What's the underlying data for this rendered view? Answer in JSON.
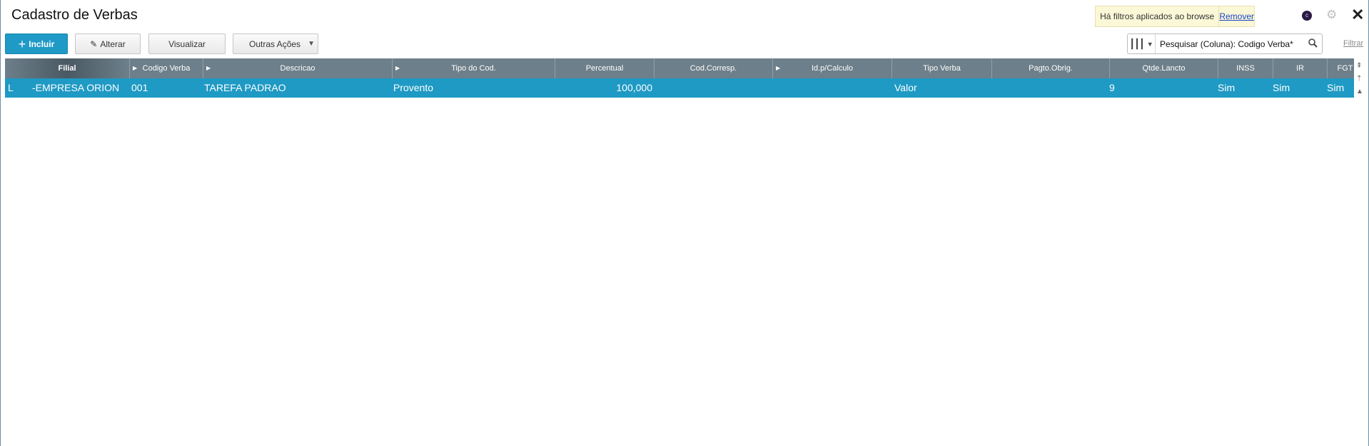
{
  "window": {
    "title": "Cadastro de Verbas",
    "filter_notice": "Há filtros aplicados ao browse",
    "filter_remove": "Remover"
  },
  "toolbar": {
    "incluir": "Incluir",
    "alterar": "Alterar",
    "visualizar": "Visualizar",
    "outras_acoes": "Outras Ações"
  },
  "search": {
    "value": "Pesquisar (Coluna): Codigo Verba*",
    "filtrar": "Filtrar"
  },
  "grid": {
    "headers": [
      "Filial",
      "Codigo Verba",
      "Descricao",
      "Tipo do Cod.",
      "Percentual",
      "Cod.Corresp.",
      "Id.p/Calculo",
      "Tipo Verba",
      "Pagto.Obrig.",
      "Qtde.Lancto",
      "INSS",
      "IR",
      "FGT"
    ],
    "row": {
      "filial_code": "L",
      "filial": "-EMPRESA ORION",
      "codigo_verba": "001",
      "descricao": "TAREFA PADRAO",
      "tipo_cod": "Provento",
      "percentual": "100,000",
      "cod_corresp": "",
      "id_calculo": "",
      "tipo_verba": "Valor",
      "pagto_obrig": "",
      "qtde_lancto": "9",
      "inss": "Sim",
      "ir": "Sim",
      "fgts": "Sim"
    }
  },
  "colors": {
    "primary": "#1f9ac6",
    "selected_row": "#1e9ac4",
    "header": "#6d7f8a",
    "notice_bg": "#fbf8d8",
    "link": "#1a45c8"
  }
}
